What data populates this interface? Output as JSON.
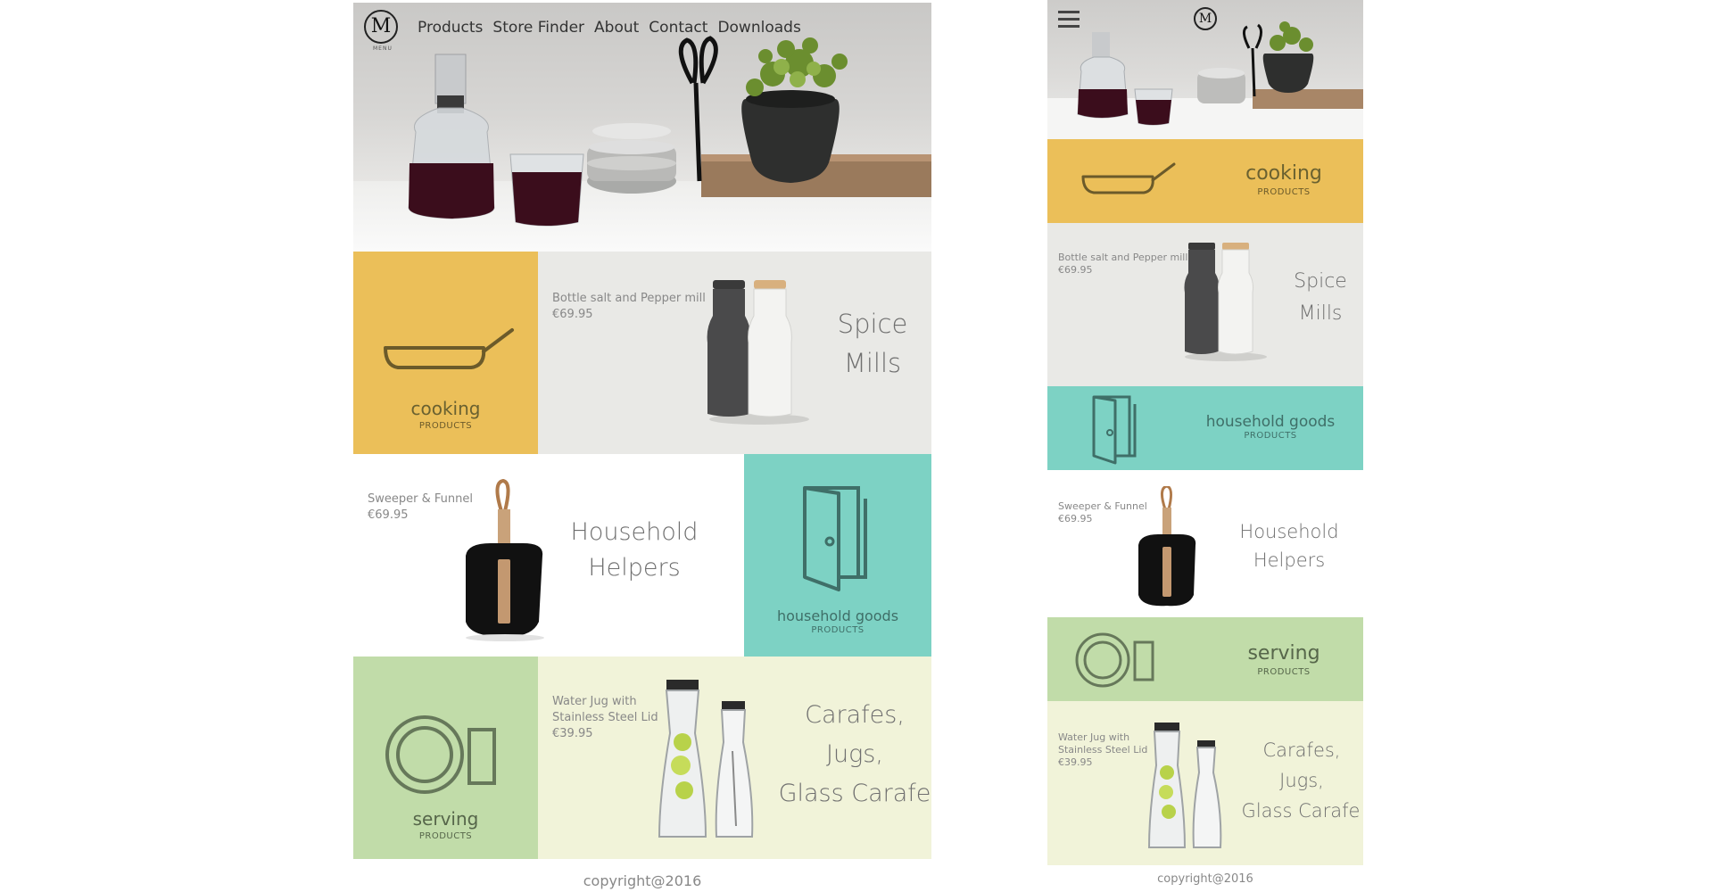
{
  "desktop": {
    "logo_letter": "M",
    "logo_caption": "MENU",
    "nav": [
      "Products",
      "Store Finder",
      "About",
      "Contact",
      "Downloads"
    ],
    "cooking": {
      "name": "cooking",
      "sub": "PRODUCTS"
    },
    "spice": {
      "product": "Bottle salt and Pepper mill",
      "price": "€69.95",
      "title_1": "Spice",
      "title_2": "Mills"
    },
    "helpers": {
      "product": "Sweeper & Funnel",
      "price": "€69.95",
      "title_1": "Household",
      "title_2": "Helpers"
    },
    "household": {
      "name": "household goods",
      "sub": "PRODUCTS"
    },
    "serving": {
      "name": "serving",
      "sub": "PRODUCTS"
    },
    "carafes": {
      "product_1": "Water Jug with",
      "product_2": "Stainless Steel Lid",
      "price": "€39.95",
      "title_1": "Carafes,",
      "title_2": "Jugs,",
      "title_3": "Glass Carafe"
    },
    "copyright": "copyright@2016"
  },
  "mobile": {
    "logo_letter": "M",
    "cooking": {
      "name": "cooking",
      "sub": "PRODUCTS"
    },
    "spice": {
      "product": "Bottle salt and Pepper mill",
      "price": "€69.95",
      "title_1": "Spice",
      "title_2": "Mills"
    },
    "household": {
      "name": "household goods",
      "sub": "PRODUCTS"
    },
    "helpers": {
      "product": "Sweeper & Funnel",
      "price": "€69.95",
      "title_1": "Household",
      "title_2": "Helpers"
    },
    "serving": {
      "name": "serving",
      "sub": "PRODUCTS"
    },
    "carafes": {
      "product_1": "Water Jug with",
      "product_2": "Stainless Steel Lid",
      "price": "€39.95",
      "title_1": "Carafes,",
      "title_2": "Jugs,",
      "title_3": "Glass Carafe"
    },
    "copyright": "copyright@2016"
  },
  "colors": {
    "cooking": "#ebbf59",
    "spice": "#e9e9e6",
    "household": "#7dd2c4",
    "serving": "#c1dca9",
    "carafes": "#f1f3d9",
    "icon_stroke_cooking": "#6b5a2a",
    "icon_stroke_household": "#3f6f68",
    "icon_stroke_serving": "#66785a"
  },
  "icons": [
    "hamburger-icon",
    "frying-pan-icon",
    "door-icon",
    "plate-and-cup-icon"
  ]
}
